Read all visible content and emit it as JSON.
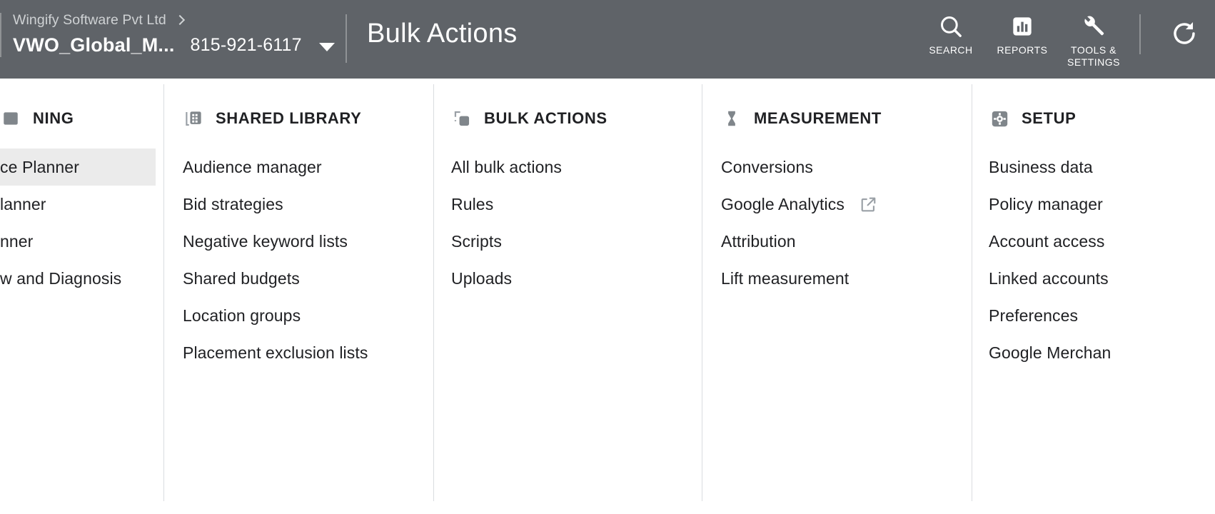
{
  "header": {
    "account": {
      "manager_name": "Wingify Software Pvt Ltd",
      "chevron_icon": "chevron-right-icon",
      "account_name": "VWO_Global_M...",
      "account_id": "815-921-6117",
      "caret_icon": "caret-down-icon"
    },
    "page_title": "Bulk Actions",
    "actions": [
      {
        "label": "SEARCH",
        "icon": "search-icon"
      },
      {
        "label": "REPORTS",
        "icon": "reports-bar-chart-icon"
      },
      {
        "label": "TOOLS & SETTINGS",
        "icon": "wrench-icon"
      }
    ],
    "refresh_icon": "refresh-icon",
    "bar_color": "#5f6368"
  },
  "menu": {
    "columns": [
      {
        "title": "NING",
        "icon": "planning-icon",
        "items": [
          {
            "label": "ce Planner",
            "selected": true,
            "external": false
          },
          {
            "label": "lanner",
            "selected": false,
            "external": false
          },
          {
            "label": "nner",
            "selected": false,
            "external": false
          },
          {
            "label": "w and Diagnosis",
            "selected": false,
            "external": false
          }
        ]
      },
      {
        "title": "SHARED LIBRARY",
        "icon": "shared-library-icon",
        "items": [
          {
            "label": "Audience manager",
            "selected": false,
            "external": false
          },
          {
            "label": "Bid strategies",
            "selected": false,
            "external": false
          },
          {
            "label": "Negative keyword lists",
            "selected": false,
            "external": false
          },
          {
            "label": "Shared budgets",
            "selected": false,
            "external": false
          },
          {
            "label": "Location groups",
            "selected": false,
            "external": false
          },
          {
            "label": "Placement exclusion lists",
            "selected": false,
            "external": false
          }
        ]
      },
      {
        "title": "BULK ACTIONS",
        "icon": "bulk-actions-icon",
        "items": [
          {
            "label": "All bulk actions",
            "selected": false,
            "external": false
          },
          {
            "label": "Rules",
            "selected": false,
            "external": false
          },
          {
            "label": "Scripts",
            "selected": false,
            "external": false
          },
          {
            "label": "Uploads",
            "selected": false,
            "external": false
          }
        ]
      },
      {
        "title": "MEASUREMENT",
        "icon": "measurement-hourglass-icon",
        "items": [
          {
            "label": "Conversions",
            "selected": false,
            "external": false
          },
          {
            "label": "Google Analytics",
            "selected": false,
            "external": true,
            "external_icon": "open-in-new-icon"
          },
          {
            "label": "Attribution",
            "selected": false,
            "external": false
          },
          {
            "label": "Lift measurement",
            "selected": false,
            "external": false
          }
        ]
      },
      {
        "title": "SETUP",
        "icon": "setup-gear-icon",
        "items": [
          {
            "label": "Business data",
            "selected": false,
            "external": false
          },
          {
            "label": "Policy manager",
            "selected": false,
            "external": false
          },
          {
            "label": "Account access",
            "selected": false,
            "external": false
          },
          {
            "label": "Linked accounts",
            "selected": false,
            "external": false
          },
          {
            "label": "Preferences",
            "selected": false,
            "external": false
          },
          {
            "label": "Google Merchan",
            "selected": false,
            "external": false
          }
        ]
      }
    ]
  },
  "colors": {
    "header_bg": "#5f6368",
    "selected_row": "#ebebeb",
    "divider": "#dadce0",
    "icon_grey": "#80868b",
    "text_primary": "#202124"
  }
}
